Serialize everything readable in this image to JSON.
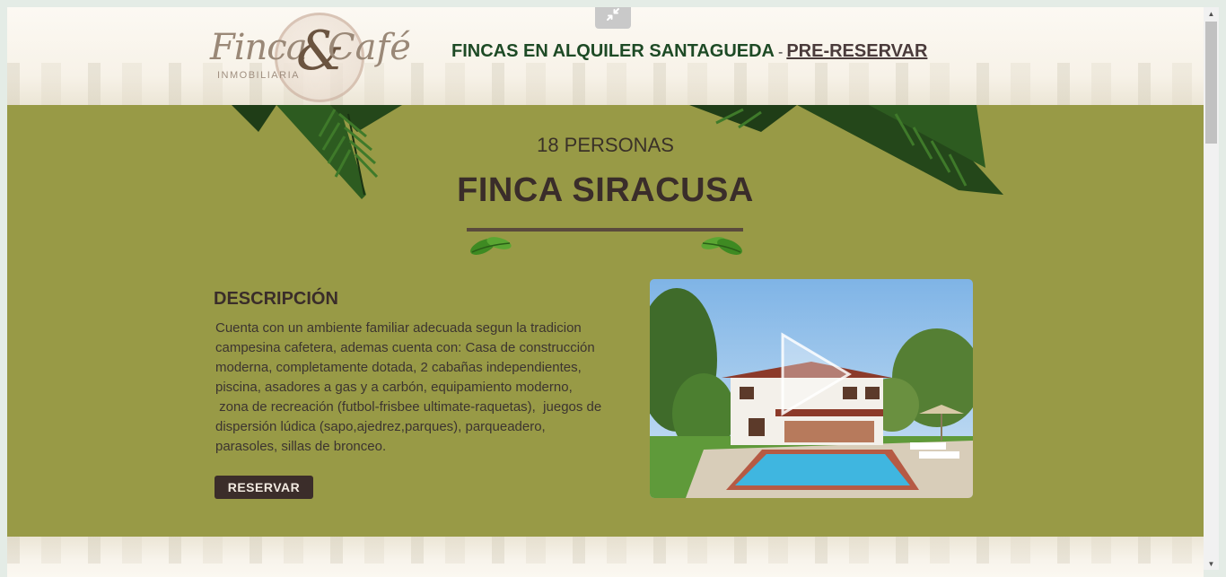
{
  "header": {
    "logo_text_1": "Finca",
    "logo_text_2": "&",
    "logo_text_3": "Café",
    "logo_sub": "INMOBILIARIA",
    "title": "FINCAS EN ALQUILER SANTAGUEDA",
    "separator": "-",
    "link": "PRE-RESERVAR"
  },
  "listing": {
    "capacity": "18 PERSONAS",
    "name": "FINCA SIRACUSA",
    "description_heading": "DESCRIPCIÓN",
    "description_lines": [
      "Cuenta con un ambiente familiar adecuada segun la tradicion",
      "campesina cafetera, ademas cuenta con:  Casa de construcción",
      "moderna,  completamente dotada,  2 cabañas independientes,",
      "piscina,  asadores a gas y a carbón,  equipamiento moderno,",
      " zona de recreación (futbol-frisbee ultimate-raquetas),  juegos de",
      "dispersión lúdica (sapo,ajedrez,parques),  parqueadero,",
      "parasoles,  sillas de bronceo."
    ],
    "reserve_label": "RESERVAR"
  },
  "colors": {
    "main_bg": "#989a46",
    "header_title": "#1d4a25",
    "button_bg": "#3b2d2a"
  },
  "icons": {
    "collapse": "collapse-arrows-icon",
    "play": "play-icon"
  }
}
